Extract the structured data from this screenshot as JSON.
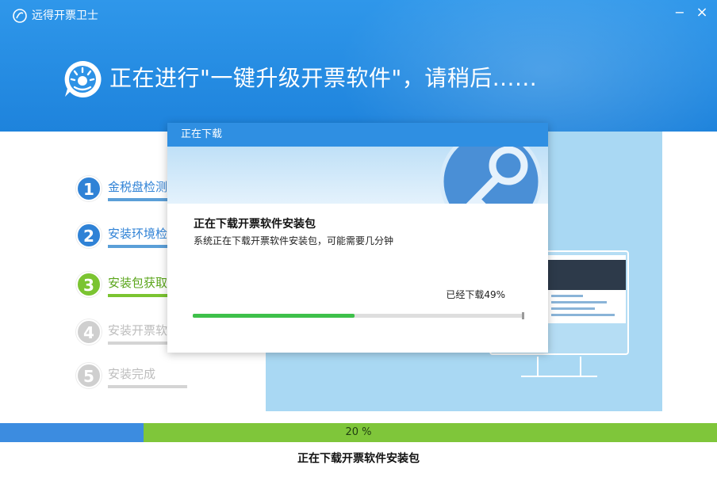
{
  "window": {
    "app_title": "远得开票卫士",
    "minimize_glyph": "−",
    "close_glyph": "×"
  },
  "hero": {
    "text": "正在进行\"一键升级开票软件\"，请稍后......",
    "icon": "sun-chat-logo-icon"
  },
  "steps": [
    {
      "number": "1",
      "label": "金税盘检测",
      "state": "done"
    },
    {
      "number": "2",
      "label": "安装环境检测",
      "state": "done"
    },
    {
      "number": "3",
      "label": "安装包获取",
      "state": "active"
    },
    {
      "number": "4",
      "label": "安装开票软件",
      "state": "pending"
    },
    {
      "number": "5",
      "label": "安装完成",
      "state": "pending"
    }
  ],
  "dialog": {
    "title": "正在下载",
    "heading": "正在下载开票软件安装包",
    "description": "系统正在下载开票软件安装包，可能需要几分钟",
    "status": "已经下载49%",
    "progress": 0.49
  },
  "overall": {
    "progress_label": "20 %",
    "progress": 0.2,
    "status_text": "正在下载开票软件安装包"
  },
  "colors": {
    "header_blue": "#2f97ea",
    "step_done": "#2f82d6",
    "step_active": "#7bc431",
    "step_pending": "#cfcfcf",
    "progress_green": "#3ec04a"
  }
}
